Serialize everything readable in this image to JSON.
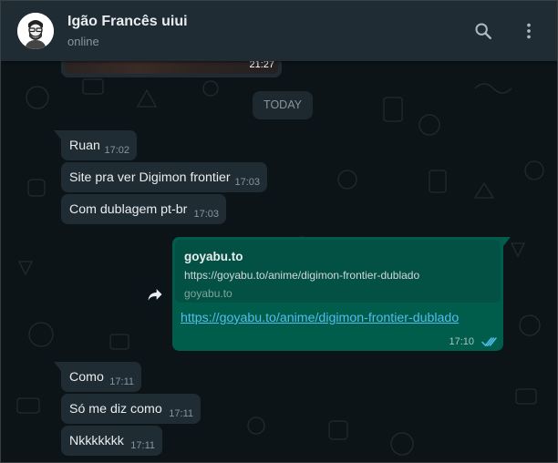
{
  "header": {
    "contact_name": "Igão Francês uiui",
    "status": "online",
    "icons": [
      "avatar",
      "search-icon",
      "menu-icon"
    ]
  },
  "chat": {
    "previous_media_time": "21:27",
    "day_separator": "TODAY",
    "incoming_top": [
      {
        "text": "Ruan",
        "time": "17:02"
      },
      {
        "text": "Site pra ver Digimon frontier",
        "time": "17:03"
      },
      {
        "text": "Com dublagem pt-br",
        "time": "17:03"
      }
    ],
    "outgoing": {
      "preview_title": "goyabu.to",
      "preview_url": "https://goyabu.to/anime/digimon-frontier-dublado",
      "preview_domain": "goyabu.to",
      "link_text": "https://goyabu.to/anime/digimon-frontier-dublado",
      "time": "17:10",
      "status_icon": "double-check-read-icon"
    },
    "incoming_bottom": [
      {
        "text": "Como",
        "time": "17:11"
      },
      {
        "text": "Só me diz como",
        "time": "17:11"
      },
      {
        "text": "Nkkkkkkk",
        "time": "17:11"
      }
    ]
  },
  "colors": {
    "header_bg": "#1f2c34",
    "incoming_bubble": "#202c33",
    "outgoing_bubble": "#005c4b",
    "link": "#53bdeb",
    "read_ticks": "#53bdeb"
  }
}
